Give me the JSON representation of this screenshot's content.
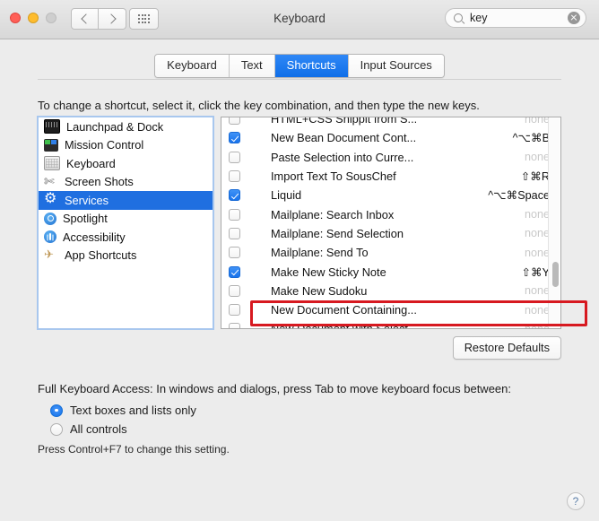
{
  "window": {
    "title": "Keyboard",
    "traffic": {
      "close": "close-button",
      "minimize": "minimize-button",
      "zoom": "zoom-button"
    }
  },
  "search": {
    "value": "key",
    "placeholder": "Search"
  },
  "tabs": [
    {
      "label": "Keyboard",
      "active": false
    },
    {
      "label": "Text",
      "active": false
    },
    {
      "label": "Shortcuts",
      "active": true
    },
    {
      "label": "Input Sources",
      "active": false
    }
  ],
  "instruction": "To change a shortcut, select it, click the key combination, and then type the new keys.",
  "sidebar": {
    "items": [
      {
        "label": "Launchpad & Dock",
        "icon": "launchpad-icon",
        "selected": false
      },
      {
        "label": "Mission Control",
        "icon": "mission-control-icon",
        "selected": false
      },
      {
        "label": "Keyboard",
        "icon": "keyboard-icon",
        "selected": false
      },
      {
        "label": "Screen Shots",
        "icon": "screenshots-icon",
        "selected": false
      },
      {
        "label": "Services",
        "icon": "services-icon",
        "selected": true
      },
      {
        "label": "Spotlight",
        "icon": "spotlight-icon",
        "selected": false
      },
      {
        "label": "Accessibility",
        "icon": "accessibility-icon",
        "selected": false
      },
      {
        "label": "App Shortcuts",
        "icon": "app-shortcuts-icon",
        "selected": false
      }
    ]
  },
  "shortcuts": {
    "rows": [
      {
        "label": "HTML+CSS Snippit from S...",
        "shortcut": "none",
        "checked": false,
        "highlighted": false
      },
      {
        "label": "New Bean Document Cont...",
        "shortcut": "^⌥⌘B",
        "checked": true,
        "highlighted": false
      },
      {
        "label": "Paste Selection into Curre...",
        "shortcut": "none",
        "checked": false,
        "highlighted": false
      },
      {
        "label": "Import Text To SousChef",
        "shortcut": "⇧⌘R",
        "checked": false,
        "highlighted": false
      },
      {
        "label": "Liquid",
        "shortcut": "^⌥⌘Space",
        "checked": true,
        "highlighted": true
      },
      {
        "label": "Mailplane: Search Inbox",
        "shortcut": "none",
        "checked": false,
        "highlighted": false
      },
      {
        "label": "Mailplane: Send Selection",
        "shortcut": "none",
        "checked": false,
        "highlighted": false
      },
      {
        "label": "Mailplane: Send To",
        "shortcut": "none",
        "checked": false,
        "highlighted": false
      },
      {
        "label": "Make New Sticky Note",
        "shortcut": "⇧⌘Y",
        "checked": true,
        "highlighted": false
      },
      {
        "label": "Make New Sudoku",
        "shortcut": "none",
        "checked": false,
        "highlighted": false
      },
      {
        "label": "New Document Containing...",
        "shortcut": "none",
        "checked": false,
        "highlighted": false
      },
      {
        "label": "New Document with Select...",
        "shortcut": "none",
        "checked": false,
        "highlighted": false
      }
    ],
    "none_text": "none"
  },
  "restore_defaults_label": "Restore Defaults",
  "full_keyboard_access": {
    "label": "Full Keyboard Access: In windows and dialogs, press Tab to move keyboard focus between:",
    "options": [
      {
        "label": "Text boxes and lists only",
        "selected": true
      },
      {
        "label": "All controls",
        "selected": false
      }
    ],
    "hint": "Press Control+F7 to change this setting."
  },
  "help_label": "?",
  "colors": {
    "accent_blue": "#1f6fe0",
    "tab_active": "#1873ec",
    "annotation_red": "#d71920",
    "window_bg": "#ececec",
    "none_gray": "#c9c9c9"
  }
}
